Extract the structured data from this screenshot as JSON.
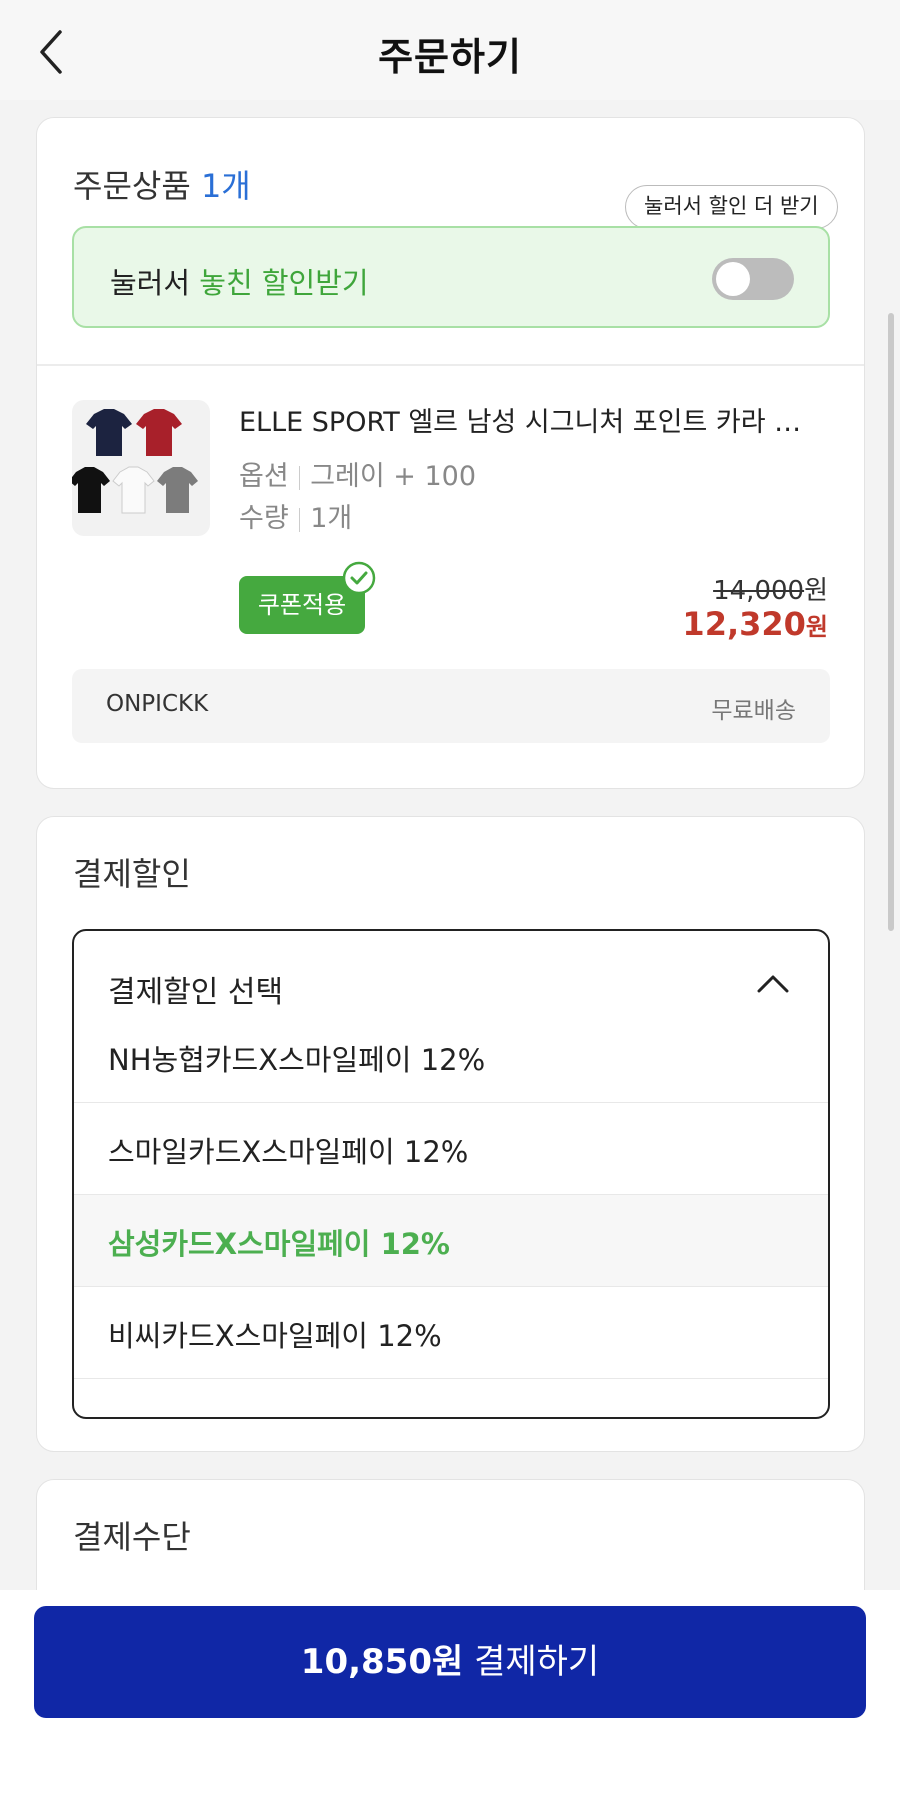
{
  "header": {
    "title": "주문하기"
  },
  "order": {
    "section_label": "주문상품",
    "count": "1개",
    "tooltip": "눌러서 할인 더 받기",
    "banner_prefix": "눌러서",
    "banner_highlight": "놓친 할인받기",
    "toggle_on": false,
    "product": {
      "name": "ELLE SPORT 엘르 남성 시그니처 포인트 카라 반팔 티셔츠",
      "option_label": "옵션",
      "option_value": "그레이 + 100",
      "qty_label": "수량",
      "qty_value": "1개",
      "coupon_badge": "쿠폰적용",
      "original_price": "14,000",
      "final_price": "12,320",
      "currency": "원"
    },
    "seller": "ONPICKK",
    "shipping": "무료배송"
  },
  "discount": {
    "section_label": "결제할인",
    "select_label": "결제할인 선택",
    "options": [
      "NH농협카드X스마일페이 12%",
      "스마일카드X스마일페이 12%",
      "삼성카드X스마일페이 12%",
      "비씨카드X스마일페이 12%"
    ],
    "selected_index": 2
  },
  "payment_method": {
    "section_label": "결제수단"
  },
  "cta": {
    "amount": "10,850원",
    "label": "결제하기"
  },
  "colors": {
    "accent_blue": "#1027a6",
    "count_blue": "#2a6fd6",
    "green": "#45a93f",
    "price_red": "#c0392b"
  }
}
